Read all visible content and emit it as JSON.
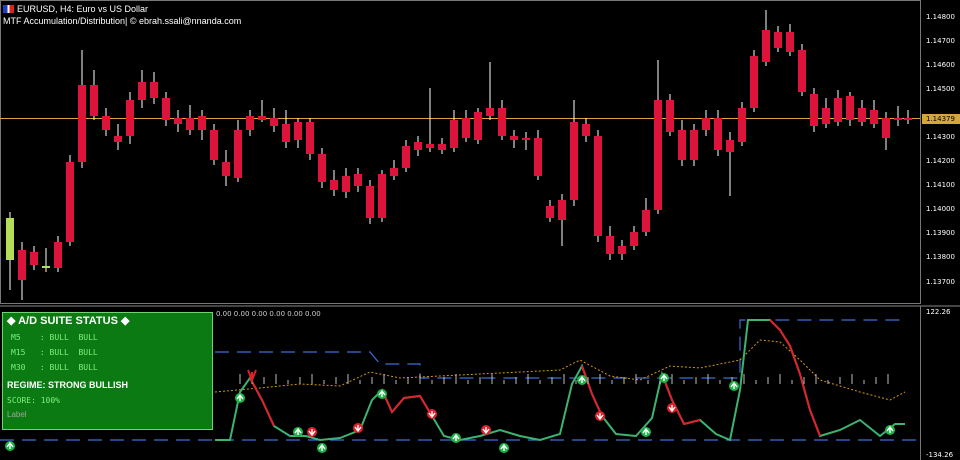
{
  "header": {
    "symbol_line": "EURUSD, H4:  Euro vs US Dollar",
    "indicator_line": "MTF Accumulation/Distribution| © ebrah.ssali@nnanda.com"
  },
  "price_axis": {
    "labels": [
      "1.14800",
      "1.14700",
      "1.14600",
      "1.14500",
      "1.14300",
      "1.14200",
      "1.14100",
      "1.14000",
      "1.13900",
      "1.13800",
      "1.13700"
    ],
    "current_price": "1.14379"
  },
  "indicator_axis": {
    "top_label": "122.26",
    "bottom_label": "-134.26"
  },
  "indicator_values_text": "0.00 0.00 0.00 0.00 0.00 0.00",
  "status_panel": {
    "title": "◆ A/D SUITE STATUS ◆",
    "rows": [
      {
        "tf": "M5",
        "a": "BULL",
        "b": "BULL"
      },
      {
        "tf": "M15",
        "a": "BULL",
        "b": "BULL"
      },
      {
        "tf": "M30",
        "a": "BULL",
        "b": "BULL"
      }
    ],
    "regime": "REGIME: STRONG BULLISH",
    "score": "SCORE: 100%",
    "label": "Label"
  },
  "colors": {
    "bull": "#b5dc56",
    "bear": "#dc143c",
    "price_line": "#d8a53a",
    "panel_bg": "#0b7a12",
    "ad_bull": "#3cb371",
    "ad_bear": "#e0202a",
    "dashed_band": "#3a6fd8",
    "signal_dotted": "#d2961e"
  }
}
